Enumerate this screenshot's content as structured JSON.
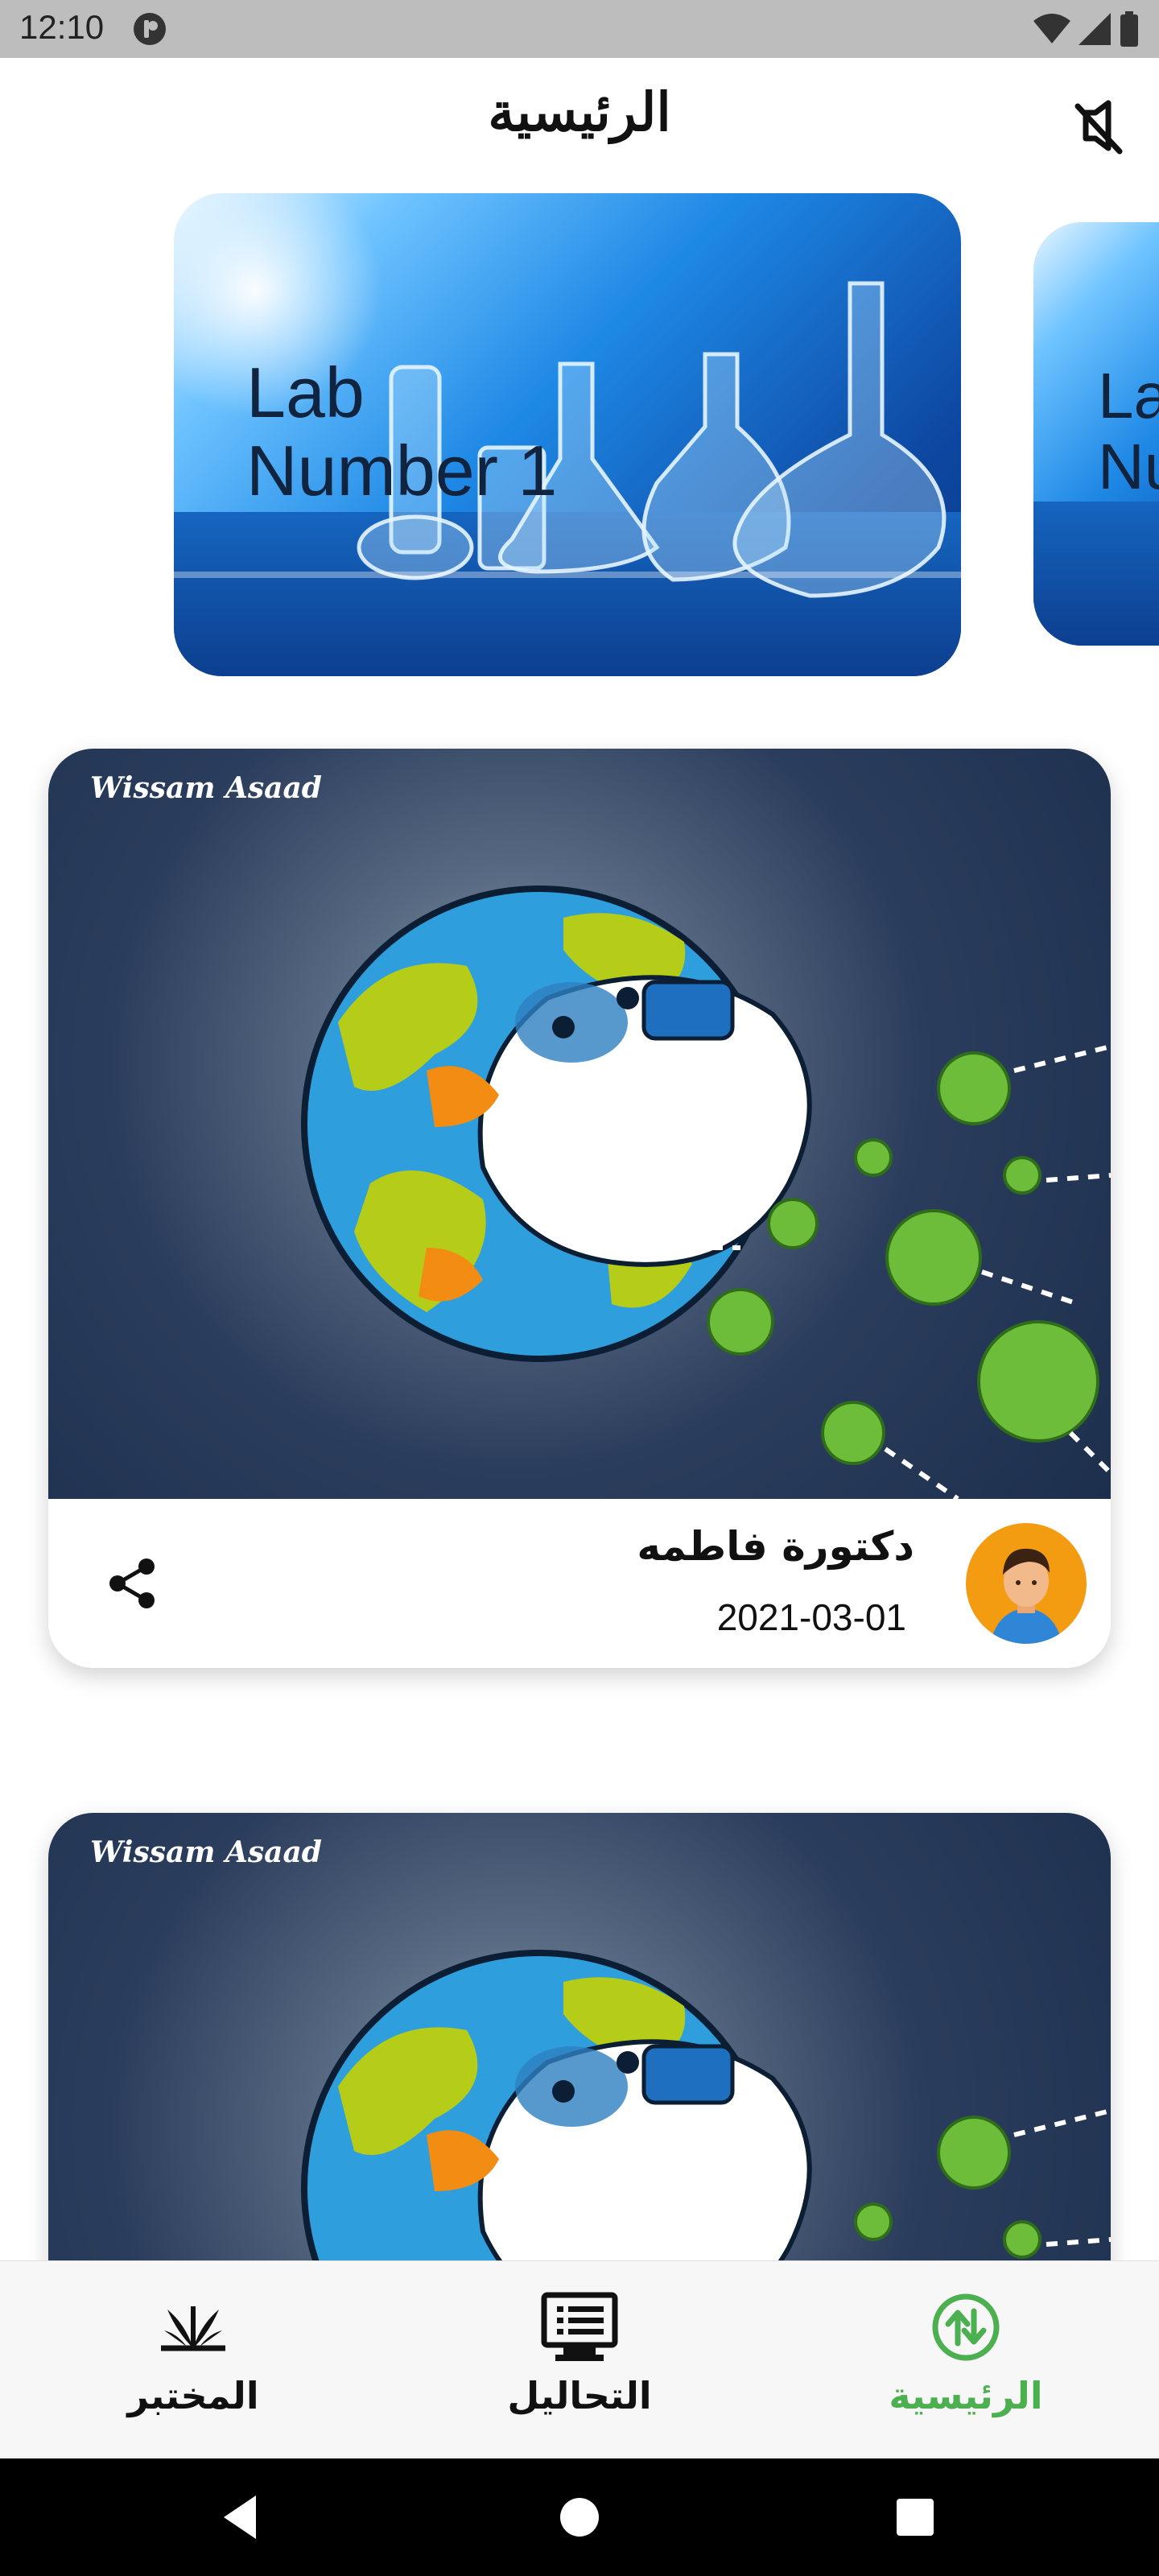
{
  "status_bar": {
    "time": "12:10",
    "icons": [
      "app-notification-icon",
      "wifi-icon",
      "signal-icon",
      "battery-icon"
    ]
  },
  "app_bar": {
    "title": "الرئيسية",
    "mute_icon": "volume-off-icon"
  },
  "carousel": {
    "items": [
      {
        "title_line1": "Lab",
        "title_line2": "Number 1"
      },
      {
        "title_line1": "La",
        "title_line2": "Nu"
      }
    ]
  },
  "posts": [
    {
      "brand": "Wissam Asaad",
      "author": "دكتورة فاطمه",
      "date": "2021-03-01",
      "share_icon": "share-icon"
    },
    {
      "brand": "Wissam Asaad"
    }
  ],
  "bottom_nav": {
    "items": [
      {
        "label": "المختبر",
        "icon": "lab-plant-icon",
        "active": false
      },
      {
        "label": "التحاليل",
        "icon": "monitor-list-icon",
        "active": false
      },
      {
        "label": "الرئيسية",
        "icon": "home-swap-icon",
        "active": true
      }
    ],
    "active_color": "#4caf50"
  },
  "system_nav": {
    "icons": [
      "back-icon",
      "home-icon",
      "recents-icon"
    ]
  }
}
